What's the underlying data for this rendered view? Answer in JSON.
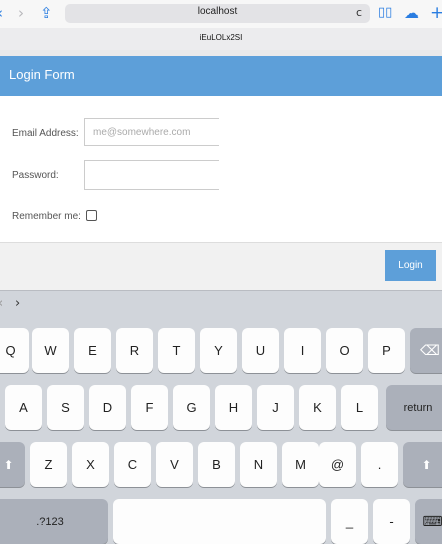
{
  "browser": {
    "url": "localhost",
    "tab_title": "iEuLOLx2SI",
    "back_icon": "‹",
    "forward_icon": "›",
    "share_icon": "⇪",
    "reload_icon": "c",
    "bookmarks_icon": "▯▯",
    "cloud_icon": "☁",
    "new_tab_icon": "+"
  },
  "form": {
    "title": "Login Form",
    "email_label": "Email Address:",
    "email_placeholder": "me@somewhere.com",
    "email_value": "",
    "password_label": "Password:",
    "password_value": "",
    "remember_label": "Remember me:",
    "remember_checked": false,
    "submit_label": "Login"
  },
  "keyboard": {
    "accessory_prev": "‹",
    "accessory_next": "›",
    "row1": [
      "Q",
      "W",
      "E",
      "R",
      "T",
      "Y",
      "U",
      "I",
      "O",
      "P"
    ],
    "delete_icon": "⌫",
    "row2": [
      "A",
      "S",
      "D",
      "F",
      "G",
      "H",
      "J",
      "K",
      "L"
    ],
    "return_label": "return",
    "shift_icon": "⬆",
    "row3": [
      "Z",
      "X",
      "C",
      "V",
      "B",
      "N",
      "M",
      "@",
      "."
    ],
    "numbers_label": ".?123",
    "underscore": "_",
    "dash": "-",
    "dismiss_icon": "⌨"
  }
}
